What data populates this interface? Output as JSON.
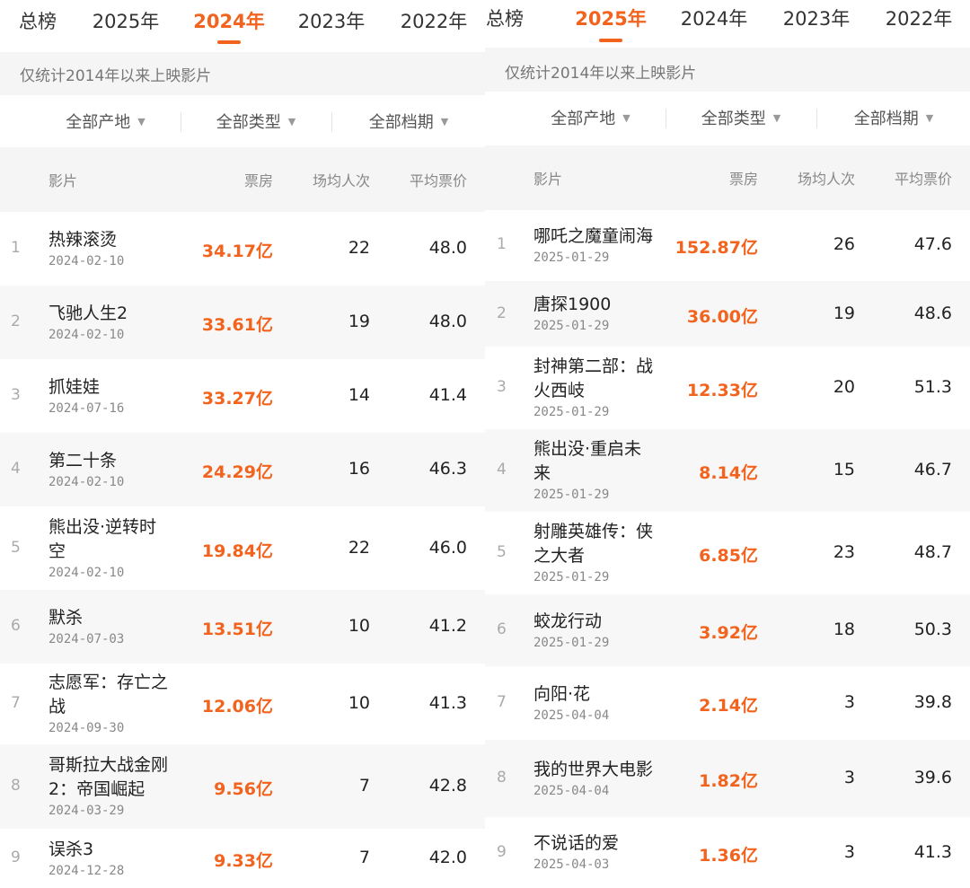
{
  "colors": {
    "accent": "#f2631e",
    "muted": "#888888",
    "band": "#f5f5f5"
  },
  "panels": [
    {
      "tabs": [
        "总榜",
        "2025年",
        "2024年",
        "2023年",
        "2022年"
      ],
      "active_tab": 2,
      "notice": "仅统计2014年以来上映影片",
      "filters": [
        "全部产地",
        "全部类型",
        "全部档期"
      ],
      "columns": [
        "影片",
        "票房",
        "场均人次",
        "平均票价"
      ],
      "rows": [
        {
          "rank": "1",
          "title": [
            "热辣滚烫"
          ],
          "date": "2024-02-10",
          "box": "34.17亿",
          "avg": "22",
          "price": "48.0"
        },
        {
          "rank": "2",
          "title": [
            "飞驰人生2"
          ],
          "date": "2024-02-10",
          "box": "33.61亿",
          "avg": "19",
          "price": "48.0"
        },
        {
          "rank": "3",
          "title": [
            "抓娃娃"
          ],
          "date": "2024-07-16",
          "box": "33.27亿",
          "avg": "14",
          "price": "41.4"
        },
        {
          "rank": "4",
          "title": [
            "第二十条"
          ],
          "date": "2024-02-10",
          "box": "24.29亿",
          "avg": "16",
          "price": "46.3"
        },
        {
          "rank": "5",
          "title": [
            "熊出没·逆转时",
            "空"
          ],
          "date": "2024-02-10",
          "box": "19.84亿",
          "avg": "22",
          "price": "46.0"
        },
        {
          "rank": "6",
          "title": [
            "默杀"
          ],
          "date": "2024-07-03",
          "box": "13.51亿",
          "avg": "10",
          "price": "41.2"
        },
        {
          "rank": "7",
          "title": [
            "志愿军：存亡之",
            "战"
          ],
          "date": "2024-09-30",
          "box": "12.06亿",
          "avg": "10",
          "price": "41.3"
        },
        {
          "rank": "8",
          "title": [
            "哥斯拉大战金刚",
            "2：帝国崛起"
          ],
          "date": "2024-03-29",
          "box": "9.56亿",
          "avg": "7",
          "price": "42.8"
        },
        {
          "rank": "9",
          "title": [
            "误杀3"
          ],
          "date": "2024-12-28",
          "box": "9.33亿",
          "avg": "7",
          "price": "42.0"
        }
      ]
    },
    {
      "tabs": [
        "总榜",
        "2025年",
        "2024年",
        "2023年",
        "2022年"
      ],
      "active_tab": 1,
      "notice": "仅统计2014年以来上映影片",
      "filters": [
        "全部产地",
        "全部类型",
        "全部档期"
      ],
      "columns": [
        "影片",
        "票房",
        "场均人次",
        "平均票价"
      ],
      "rows": [
        {
          "rank": "1",
          "title": [
            "哪吒之魔童闹海"
          ],
          "date": "2025-01-29",
          "box": "152.87亿",
          "avg": "26",
          "price": "47.6"
        },
        {
          "rank": "2",
          "title": [
            "唐探1900"
          ],
          "date": "2025-01-29",
          "box": "36.00亿",
          "avg": "19",
          "price": "48.6"
        },
        {
          "rank": "3",
          "title": [
            "封神第二部：战",
            "火西岐"
          ],
          "date": "2025-01-29",
          "box": "12.33亿",
          "avg": "20",
          "price": "51.3"
        },
        {
          "rank": "4",
          "title": [
            "熊出没·重启未",
            "来"
          ],
          "date": "2025-01-29",
          "box": "8.14亿",
          "avg": "15",
          "price": "46.7"
        },
        {
          "rank": "5",
          "title": [
            "射雕英雄传：侠",
            "之大者"
          ],
          "date": "2025-01-29",
          "box": "6.85亿",
          "avg": "23",
          "price": "48.7"
        },
        {
          "rank": "6",
          "title": [
            "蛟龙行动"
          ],
          "date": "2025-01-29",
          "box": "3.92亿",
          "avg": "18",
          "price": "50.3"
        },
        {
          "rank": "7",
          "title": [
            "向阳·花"
          ],
          "date": "2025-04-04",
          "box": "2.14亿",
          "avg": "3",
          "price": "39.8"
        },
        {
          "rank": "8",
          "title": [
            "我的世界大电影"
          ],
          "date": "2025-04-04",
          "box": "1.82亿",
          "avg": "3",
          "price": "39.6"
        },
        {
          "rank": "9",
          "title": [
            "不说话的爱"
          ],
          "date": "2025-04-03",
          "box": "1.36亿",
          "avg": "3",
          "price": "41.3"
        }
      ]
    }
  ]
}
